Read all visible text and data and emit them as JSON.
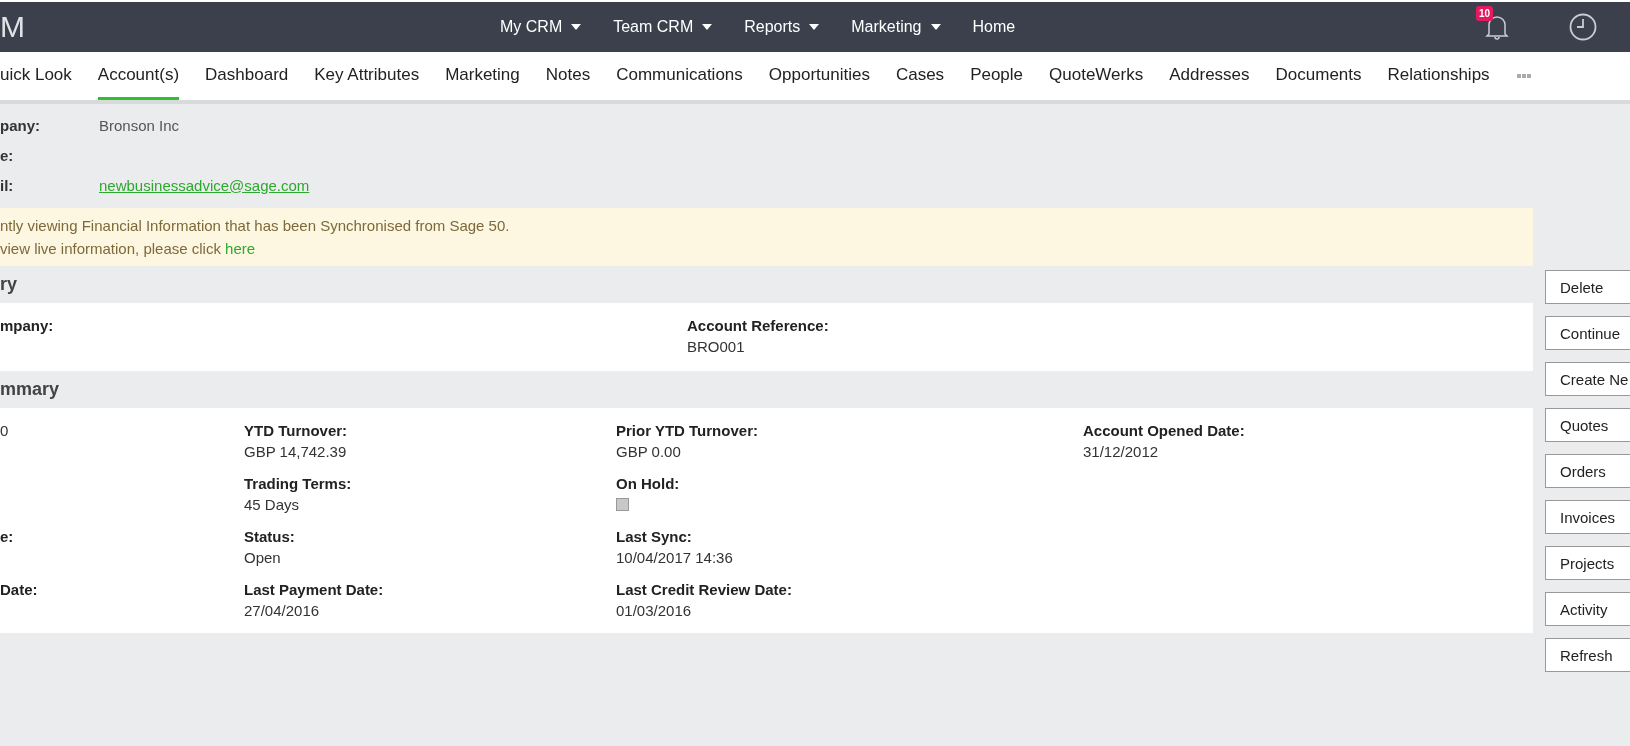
{
  "top_bar": {
    "logo": "M",
    "nav": [
      {
        "label": "My CRM",
        "dropdown": true
      },
      {
        "label": "Team CRM",
        "dropdown": true
      },
      {
        "label": "Reports",
        "dropdown": true
      },
      {
        "label": "Marketing",
        "dropdown": true
      },
      {
        "label": "Home",
        "dropdown": false
      }
    ],
    "notification_count": "10"
  },
  "tabs": [
    {
      "label": "uick Look",
      "selected": false
    },
    {
      "label": "Account(s)",
      "selected": true
    },
    {
      "label": "Dashboard",
      "selected": false
    },
    {
      "label": "Key Attributes",
      "selected": false
    },
    {
      "label": "Marketing",
      "selected": false
    },
    {
      "label": "Notes",
      "selected": false
    },
    {
      "label": "Communications",
      "selected": false
    },
    {
      "label": "Opportunities",
      "selected": false
    },
    {
      "label": "Cases",
      "selected": false
    },
    {
      "label": "People",
      "selected": false
    },
    {
      "label": "QuoteWerks",
      "selected": false
    },
    {
      "label": "Addresses",
      "selected": false
    },
    {
      "label": "Documents",
      "selected": false
    },
    {
      "label": "Relationships",
      "selected": false
    }
  ],
  "header_fields": [
    {
      "label": "pany:",
      "value": "Bronson Inc",
      "kind": "text"
    },
    {
      "label": "e:"
    },
    {
      "label": "il:",
      "value": "newbusinessadvice@sage.com",
      "kind": "link"
    }
  ],
  "notice": {
    "line_1": "ntly viewing Financial Information that has been Synchronised from Sage 50.",
    "line_2": "view live information, please click ",
    "link": "here"
  },
  "sections": [
    {
      "title": "ry",
      "kind": "reference",
      "fields": [
        {
          "label": "mpany:"
        },
        {
          "label": "Account Reference:",
          "value": "BRO001"
        }
      ]
    },
    {
      "title": "mmary",
      "kind": "summary",
      "fields": [
        {
          "value": "0"
        },
        {
          "label": "YTD Turnover:",
          "value": "GBP 14,742.39"
        },
        {
          "label": "Prior YTD Turnover:",
          "value": "GBP 0.00"
        },
        {
          "label": "Account Opened Date:",
          "value": "31/12/2012"
        },
        {
          "kind": "blank"
        },
        {
          "label": "Trading Terms:",
          "value": "45 Days"
        },
        {
          "label": "On Hold:",
          "kind": "checkbox",
          "checked": false,
          "disabled": true
        },
        {
          "kind": "blank"
        },
        {
          "label": "e:"
        },
        {
          "label": "Status:",
          "value": "Open"
        },
        {
          "label": "Last Sync:",
          "value": "10/04/2017 14:36"
        },
        {
          "kind": "blank"
        },
        {
          "label": "Date:"
        },
        {
          "label": "Last Payment Date:",
          "value": "27/04/2016"
        },
        {
          "label": "Last Credit Review Date:",
          "value": "01/03/2016"
        },
        {
          "kind": "blank"
        }
      ]
    }
  ],
  "actions": [
    "Delete",
    "Continue",
    "Create Ne",
    "Quotes",
    "Orders",
    "Invoices",
    "Projects",
    "Activity",
    "Refresh"
  ]
}
